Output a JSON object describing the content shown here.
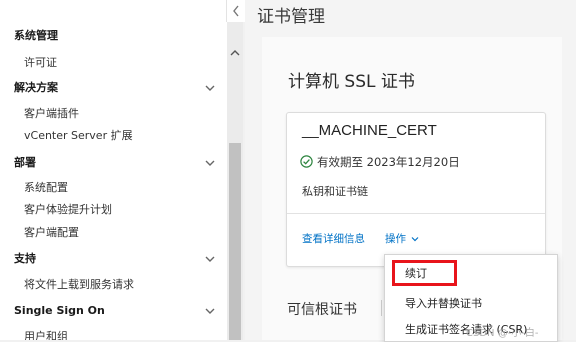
{
  "sidebar": {
    "sections": [
      {
        "label": "系统管理",
        "items": [
          "许可证"
        ],
        "expanded": true
      },
      {
        "label": "解决方案",
        "items": [
          "客户端插件",
          "vCenter Server 扩展"
        ],
        "expanded": true
      },
      {
        "label": "部署",
        "items": [
          "系统配置",
          "客户体验提升计划",
          "客户端配置"
        ],
        "expanded": true
      },
      {
        "label": "支持",
        "items": [
          "将文件上载到服务请求"
        ],
        "expanded": true
      },
      {
        "label": "Single Sign On",
        "items": [
          "用户和组"
        ],
        "expanded": true
      }
    ]
  },
  "main": {
    "page_title": "证书管理",
    "card_title": "计算机 SSL 证书",
    "cert": {
      "name": "__MACHINE_CERT",
      "validity": "有效期至 2023年12月20日",
      "type": "私钥和证书链",
      "detail_link": "查看详细信息",
      "actions_label": "操作"
    },
    "trusted_title": "可信根证书"
  },
  "menu": {
    "items": [
      "续订",
      "导入并替换证书",
      "生成证书签名请求 (CSR)"
    ],
    "highlighted": "续订"
  },
  "watermark": "CSDN @-小-白-",
  "colors": {
    "link": "#0072c6",
    "highlight_box": "#e8141b",
    "valid_check": "#2e8540"
  }
}
